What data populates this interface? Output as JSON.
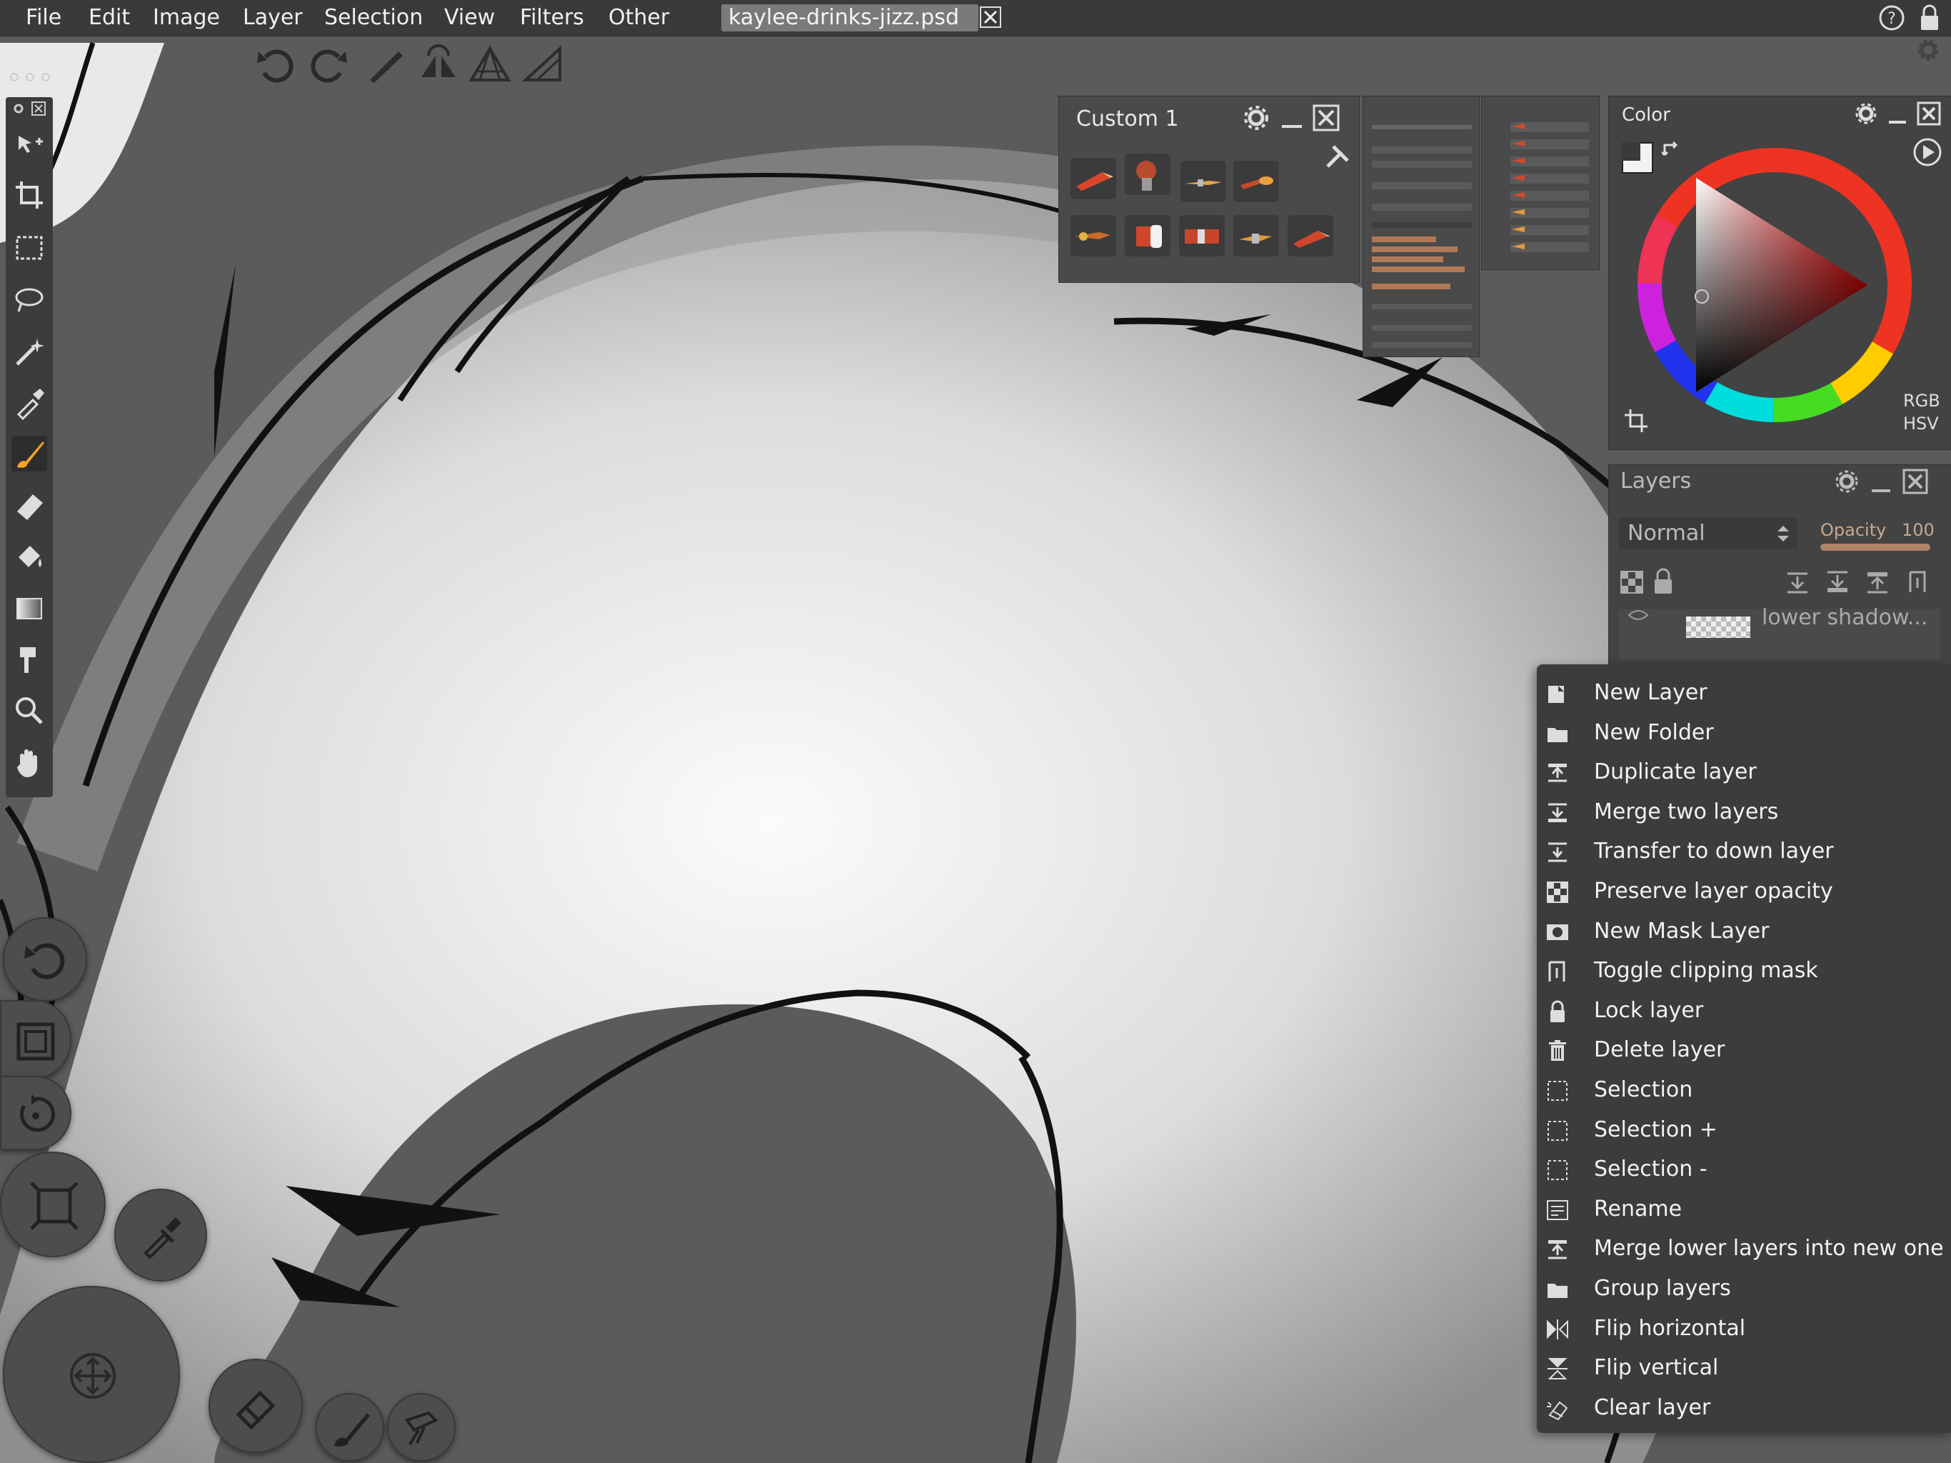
{
  "menubar": {
    "items": [
      "File",
      "Edit",
      "Image",
      "Layer",
      "Selection",
      "View",
      "Filters",
      "Other"
    ],
    "document_tab": "kaylee-drinks-jizz.psd"
  },
  "brush_panel": {
    "title": "Custom 1"
  },
  "color_panel": {
    "title": "Color",
    "mode_rgb": "RGB",
    "mode_hsv": "HSV"
  },
  "layers_panel": {
    "title": "Layers",
    "blend_mode": "Normal",
    "opacity_label": "Opacity",
    "opacity_value": "100",
    "layer_name": "lower shadow..."
  },
  "context_menu": {
    "items": [
      {
        "label": "New Layer",
        "icon": "new-layer-icon"
      },
      {
        "label": "New Folder",
        "icon": "folder-icon"
      },
      {
        "label": "Duplicate layer",
        "icon": "duplicate-icon"
      },
      {
        "label": "Merge two layers",
        "icon": "merge-icon"
      },
      {
        "label": "Transfer to down layer",
        "icon": "transfer-icon"
      },
      {
        "label": "Preserve layer opacity",
        "icon": "checker-icon"
      },
      {
        "label": "New Mask Layer",
        "icon": "mask-icon"
      },
      {
        "label": "Toggle clipping mask",
        "icon": "clip-icon"
      },
      {
        "label": "Lock layer",
        "icon": "lock-icon"
      },
      {
        "label": "Delete layer",
        "icon": "trash-icon"
      },
      {
        "label": "Selection",
        "icon": "selection-icon"
      },
      {
        "label": "Selection  +",
        "icon": "selection-icon"
      },
      {
        "label": "Selection  -",
        "icon": "selection-icon"
      },
      {
        "label": "Rename",
        "icon": "rename-icon"
      },
      {
        "label": "Merge lower layers into new one",
        "icon": "merge-lower-icon"
      },
      {
        "label": "Group layers",
        "icon": "folder-icon"
      },
      {
        "label": "Flip horizontal",
        "icon": "flip-h-icon"
      },
      {
        "label": "Flip vertical",
        "icon": "flip-v-icon"
      },
      {
        "label": "Clear layer",
        "icon": "clear-icon"
      }
    ]
  },
  "colors": {
    "menubar": "#3a3a3a",
    "panel": "#454545",
    "canvas_bg": "#5b5b5b"
  }
}
